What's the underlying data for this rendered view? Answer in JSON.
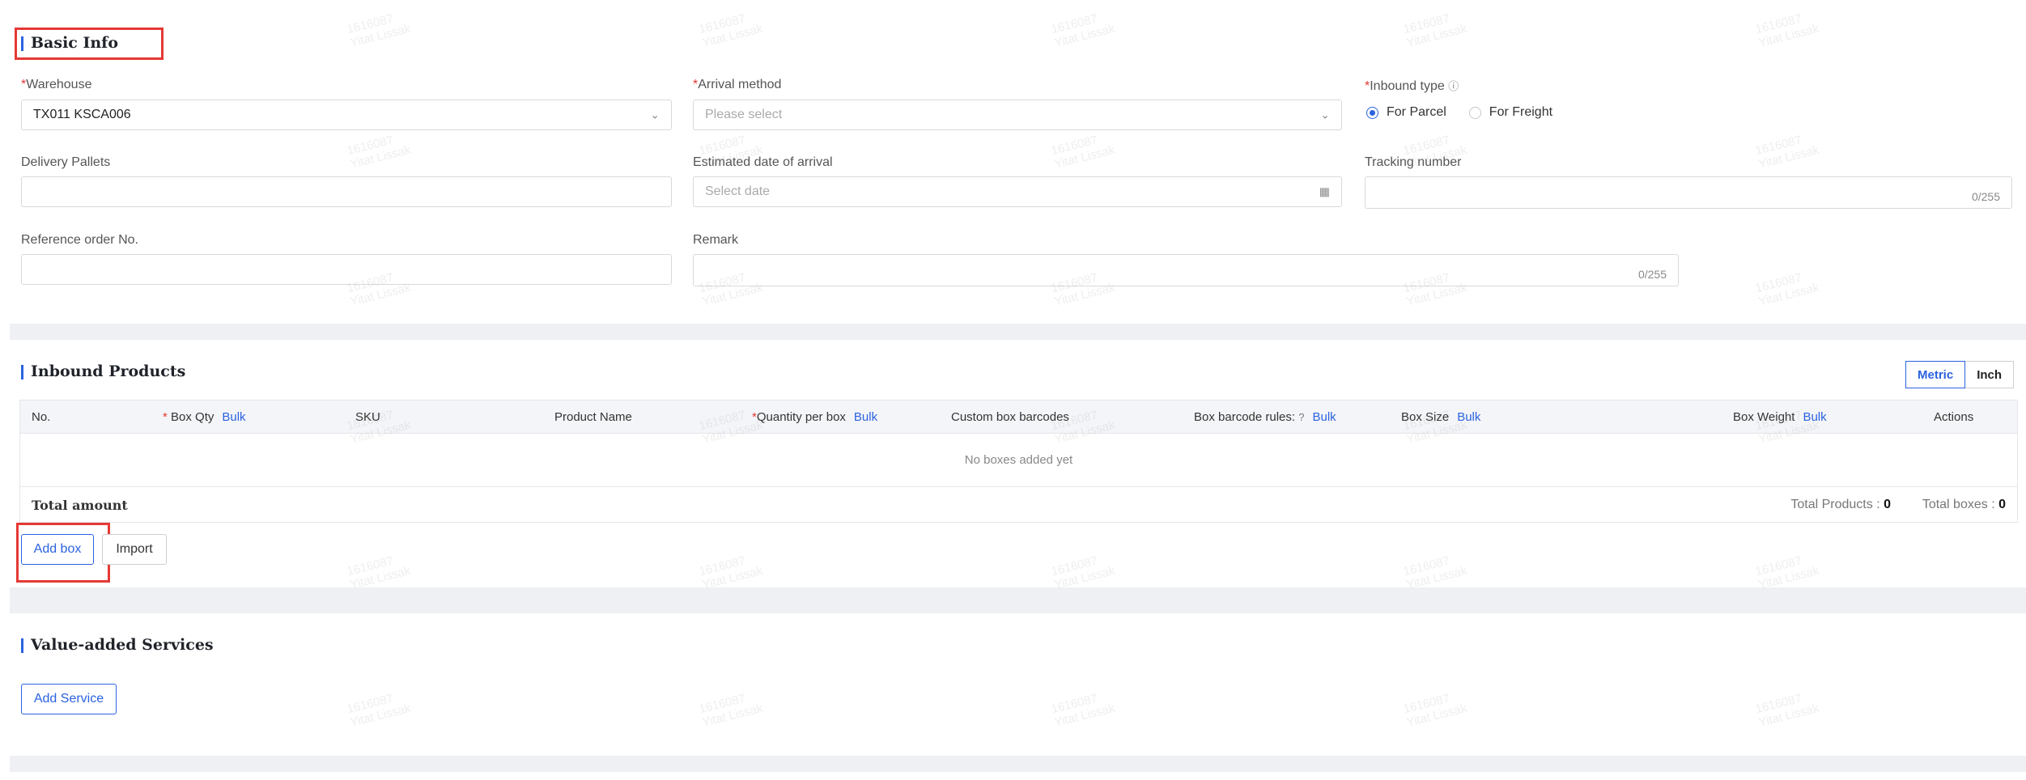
{
  "basic_info": {
    "title": "Basic Info",
    "warehouse": {
      "label": "Warehouse",
      "value": "TX011 KSCA006"
    },
    "arrival_method": {
      "label": "Arrival method",
      "placeholder": "Please select"
    },
    "inbound_type": {
      "label": "Inbound type",
      "options": [
        "For Parcel",
        "For Freight"
      ],
      "selected": "For Parcel"
    },
    "delivery_pallets": {
      "label": "Delivery Pallets",
      "value": ""
    },
    "estimated_date": {
      "label": "Estimated date of arrival",
      "placeholder": "Select date"
    },
    "tracking_number": {
      "label": "Tracking number",
      "counter": "0/255"
    },
    "reference_order": {
      "label": "Reference order No.",
      "value": ""
    },
    "remark": {
      "label": "Remark",
      "counter": "0/255"
    }
  },
  "inbound_products": {
    "title": "Inbound Products",
    "unit_toggle": {
      "options": [
        "Metric",
        "Inch"
      ],
      "selected": "Metric"
    },
    "columns": {
      "no": "No.",
      "box_qty": "Box Qty",
      "sku": "SKU",
      "product_name": "Product Name",
      "qty_per_box": "Quantity per box",
      "custom_barcodes": "Custom box barcodes",
      "barcode_rules": "Box barcode rules:",
      "box_size": "Box Size",
      "box_weight": "Box Weight",
      "actions": "Actions",
      "bulk": "Bulk"
    },
    "empty_text": "No boxes added yet",
    "total_label": "Total amount",
    "total_products_label": "Total Products :",
    "total_products_value": "0",
    "total_boxes_label": "Total boxes :",
    "total_boxes_value": "0",
    "add_box_label": "Add box",
    "import_label": "Import"
  },
  "value_added": {
    "title": "Value-added Services",
    "add_service_label": "Add Service"
  },
  "watermark": {
    "line1": "1616087",
    "line2": "Yitat Lissak"
  },
  "colors": {
    "accent": "#2b62e0",
    "required": "#e53935",
    "highlight": "#e53935"
  }
}
